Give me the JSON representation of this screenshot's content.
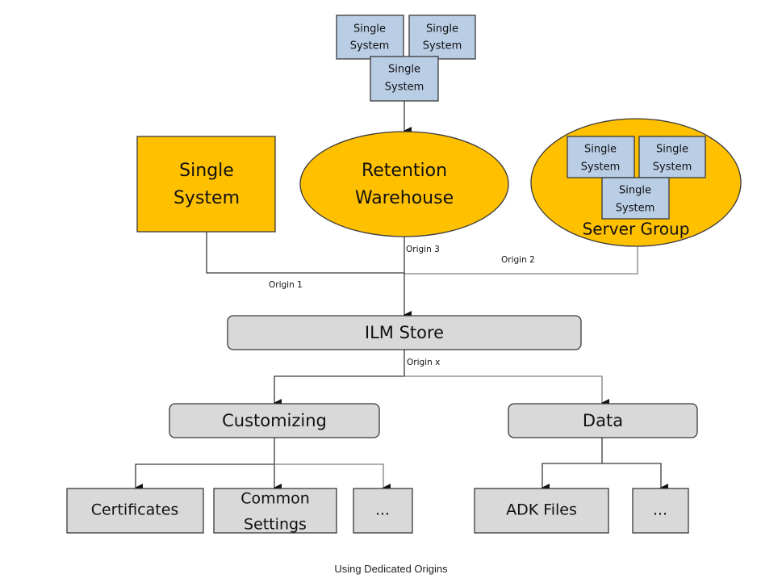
{
  "diagram": {
    "caption": "Using Dedicated Origins",
    "colors": {
      "orange_fill": "#FFC000",
      "blue_fill": "#B9CDE5",
      "gray_fill": "#D9D9D9",
      "stroke": "#3a3a3a",
      "connector_light": "#7f7f7f"
    },
    "top_cluster": {
      "boxes": [
        {
          "line1": "Single",
          "line2": "System"
        },
        {
          "line1": "Single",
          "line2": "System"
        },
        {
          "line1": "Single",
          "line2": "System"
        }
      ]
    },
    "single_system": {
      "line1": "Single",
      "line2": "System"
    },
    "retention_warehouse": {
      "line1": "Retention",
      "line2": "Warehouse"
    },
    "server_group": {
      "label": "Server Group",
      "boxes": [
        {
          "line1": "Single",
          "line2": "System"
        },
        {
          "line1": "Single",
          "line2": "System"
        },
        {
          "line1": "Single",
          "line2": "System"
        }
      ]
    },
    "edges": {
      "origin1": "Origin 1",
      "origin2": "Origin 2",
      "origin3": "Origin 3",
      "originx": "Origin x"
    },
    "ilm_store": "ILM Store",
    "customizing": {
      "label": "Customizing",
      "children": [
        {
          "line1": "Certificates",
          "line2": ""
        },
        {
          "line1": "Common",
          "line2": "Settings"
        },
        {
          "line1": "...",
          "line2": ""
        }
      ]
    },
    "data": {
      "label": "Data",
      "children": [
        {
          "line1": "ADK Files"
        },
        {
          "line1": "..."
        }
      ]
    }
  }
}
